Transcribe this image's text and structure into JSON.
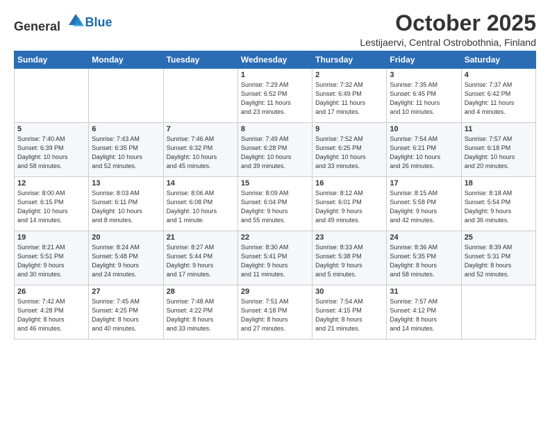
{
  "header": {
    "logo_general": "General",
    "logo_blue": "Blue",
    "month": "October 2025",
    "location": "Lestijaervi, Central Ostrobothnia, Finland"
  },
  "weekdays": [
    "Sunday",
    "Monday",
    "Tuesday",
    "Wednesday",
    "Thursday",
    "Friday",
    "Saturday"
  ],
  "weeks": [
    [
      {
        "day": "",
        "info": ""
      },
      {
        "day": "",
        "info": ""
      },
      {
        "day": "",
        "info": ""
      },
      {
        "day": "1",
        "info": "Sunrise: 7:29 AM\nSunset: 6:52 PM\nDaylight: 11 hours\nand 23 minutes."
      },
      {
        "day": "2",
        "info": "Sunrise: 7:32 AM\nSunset: 6:49 PM\nDaylight: 11 hours\nand 17 minutes."
      },
      {
        "day": "3",
        "info": "Sunrise: 7:35 AM\nSunset: 6:45 PM\nDaylight: 11 hours\nand 10 minutes."
      },
      {
        "day": "4",
        "info": "Sunrise: 7:37 AM\nSunset: 6:42 PM\nDaylight: 11 hours\nand 4 minutes."
      }
    ],
    [
      {
        "day": "5",
        "info": "Sunrise: 7:40 AM\nSunset: 6:39 PM\nDaylight: 10 hours\nand 58 minutes."
      },
      {
        "day": "6",
        "info": "Sunrise: 7:43 AM\nSunset: 6:35 PM\nDaylight: 10 hours\nand 52 minutes."
      },
      {
        "day": "7",
        "info": "Sunrise: 7:46 AM\nSunset: 6:32 PM\nDaylight: 10 hours\nand 45 minutes."
      },
      {
        "day": "8",
        "info": "Sunrise: 7:49 AM\nSunset: 6:28 PM\nDaylight: 10 hours\nand 39 minutes."
      },
      {
        "day": "9",
        "info": "Sunrise: 7:52 AM\nSunset: 6:25 PM\nDaylight: 10 hours\nand 33 minutes."
      },
      {
        "day": "10",
        "info": "Sunrise: 7:54 AM\nSunset: 6:21 PM\nDaylight: 10 hours\nand 26 minutes."
      },
      {
        "day": "11",
        "info": "Sunrise: 7:57 AM\nSunset: 6:18 PM\nDaylight: 10 hours\nand 20 minutes."
      }
    ],
    [
      {
        "day": "12",
        "info": "Sunrise: 8:00 AM\nSunset: 6:15 PM\nDaylight: 10 hours\nand 14 minutes."
      },
      {
        "day": "13",
        "info": "Sunrise: 8:03 AM\nSunset: 6:11 PM\nDaylight: 10 hours\nand 8 minutes."
      },
      {
        "day": "14",
        "info": "Sunrise: 8:06 AM\nSunset: 6:08 PM\nDaylight: 10 hours\nand 1 minute."
      },
      {
        "day": "15",
        "info": "Sunrise: 8:09 AM\nSunset: 6:04 PM\nDaylight: 9 hours\nand 55 minutes."
      },
      {
        "day": "16",
        "info": "Sunrise: 8:12 AM\nSunset: 6:01 PM\nDaylight: 9 hours\nand 49 minutes."
      },
      {
        "day": "17",
        "info": "Sunrise: 8:15 AM\nSunset: 5:58 PM\nDaylight: 9 hours\nand 42 minutes."
      },
      {
        "day": "18",
        "info": "Sunrise: 8:18 AM\nSunset: 5:54 PM\nDaylight: 9 hours\nand 36 minutes."
      }
    ],
    [
      {
        "day": "19",
        "info": "Sunrise: 8:21 AM\nSunset: 5:51 PM\nDaylight: 9 hours\nand 30 minutes."
      },
      {
        "day": "20",
        "info": "Sunrise: 8:24 AM\nSunset: 5:48 PM\nDaylight: 9 hours\nand 24 minutes."
      },
      {
        "day": "21",
        "info": "Sunrise: 8:27 AM\nSunset: 5:44 PM\nDaylight: 9 hours\nand 17 minutes."
      },
      {
        "day": "22",
        "info": "Sunrise: 8:30 AM\nSunset: 5:41 PM\nDaylight: 9 hours\nand 11 minutes."
      },
      {
        "day": "23",
        "info": "Sunrise: 8:33 AM\nSunset: 5:38 PM\nDaylight: 9 hours\nand 5 minutes."
      },
      {
        "day": "24",
        "info": "Sunrise: 8:36 AM\nSunset: 5:35 PM\nDaylight: 8 hours\nand 58 minutes."
      },
      {
        "day": "25",
        "info": "Sunrise: 8:39 AM\nSunset: 5:31 PM\nDaylight: 8 hours\nand 52 minutes."
      }
    ],
    [
      {
        "day": "26",
        "info": "Sunrise: 7:42 AM\nSunset: 4:28 PM\nDaylight: 8 hours\nand 46 minutes."
      },
      {
        "day": "27",
        "info": "Sunrise: 7:45 AM\nSunset: 4:25 PM\nDaylight: 8 hours\nand 40 minutes."
      },
      {
        "day": "28",
        "info": "Sunrise: 7:48 AM\nSunset: 4:22 PM\nDaylight: 8 hours\nand 33 minutes."
      },
      {
        "day": "29",
        "info": "Sunrise: 7:51 AM\nSunset: 4:18 PM\nDaylight: 8 hours\nand 27 minutes."
      },
      {
        "day": "30",
        "info": "Sunrise: 7:54 AM\nSunset: 4:15 PM\nDaylight: 8 hours\nand 21 minutes."
      },
      {
        "day": "31",
        "info": "Sunrise: 7:57 AM\nSunset: 4:12 PM\nDaylight: 8 hours\nand 14 minutes."
      },
      {
        "day": "",
        "info": ""
      }
    ]
  ]
}
